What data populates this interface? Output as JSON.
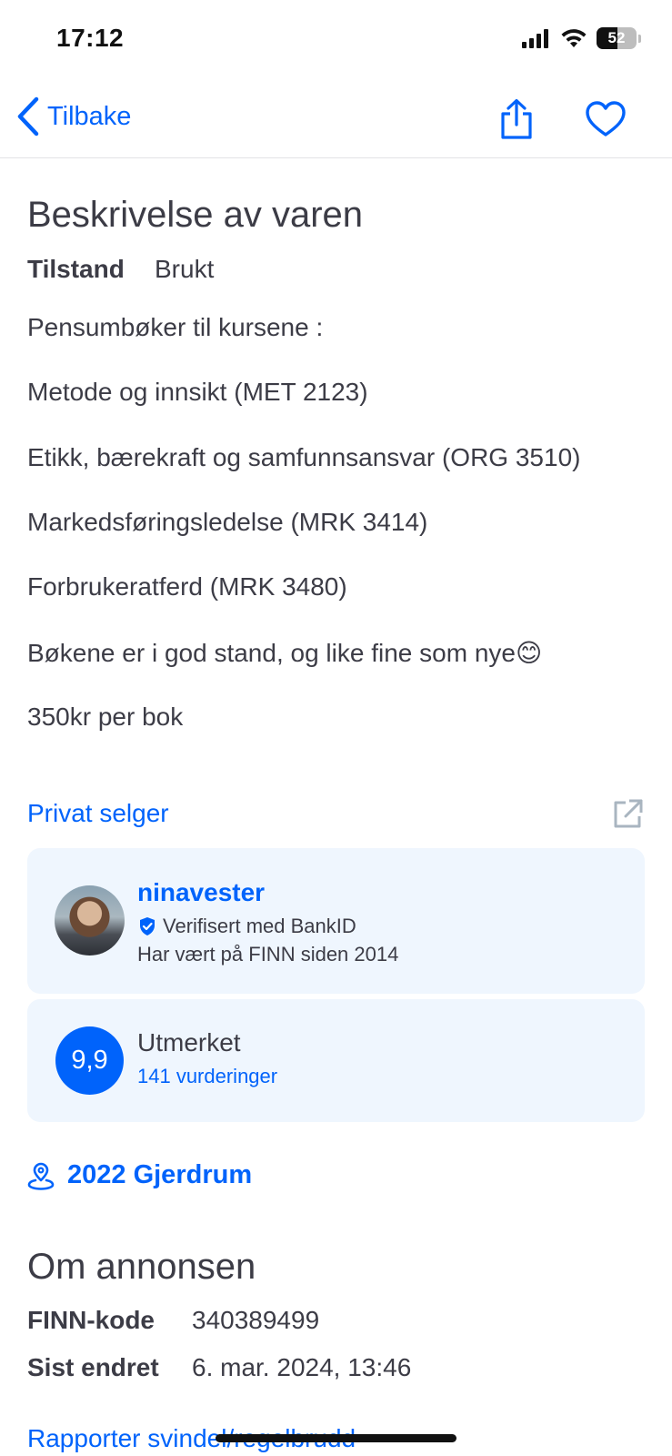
{
  "status_bar": {
    "time": "17:12",
    "battery": "52"
  },
  "nav": {
    "back_label": "Tilbake",
    "share_icon": "share-icon",
    "favorite_icon": "heart-icon"
  },
  "description": {
    "title": "Beskrivelse av varen",
    "condition_label": "Tilstand",
    "condition_value": "Brukt",
    "lines": [
      "Pensumbøker til kursene :",
      "Metode og innsikt (MET 2123)",
      "Etikk, bærekraft og samfunnsansvar (ORG 3510)",
      "Markedsføringsledelse (MRK 3414)",
      "Forbrukeratferd (MRK 3480)",
      "Bøkene er i god stand, og like fine som nye😊",
      "350kr per bok"
    ]
  },
  "seller": {
    "section_label": "Privat selger",
    "username": "ninavester",
    "verified": "Verifisert med BankID",
    "member_since": "Har vært på FINN siden 2014"
  },
  "rating": {
    "score": "9,9",
    "label": "Utmerket",
    "count": "141 vurderinger"
  },
  "location": {
    "text": "2022 Gjerdrum"
  },
  "about": {
    "title": "Om annonsen",
    "finn_code_label": "FINN-kode",
    "finn_code_value": "340389499",
    "last_changed_label": "Sist endret",
    "last_changed_value": "6. mar. 2024, 13:46"
  },
  "footer": {
    "report_link": "Rapporter svindel/regelbrudd"
  },
  "colors": {
    "accent": "#0063fb",
    "text": "#3c3c46",
    "card_bg": "#eff6fe"
  }
}
